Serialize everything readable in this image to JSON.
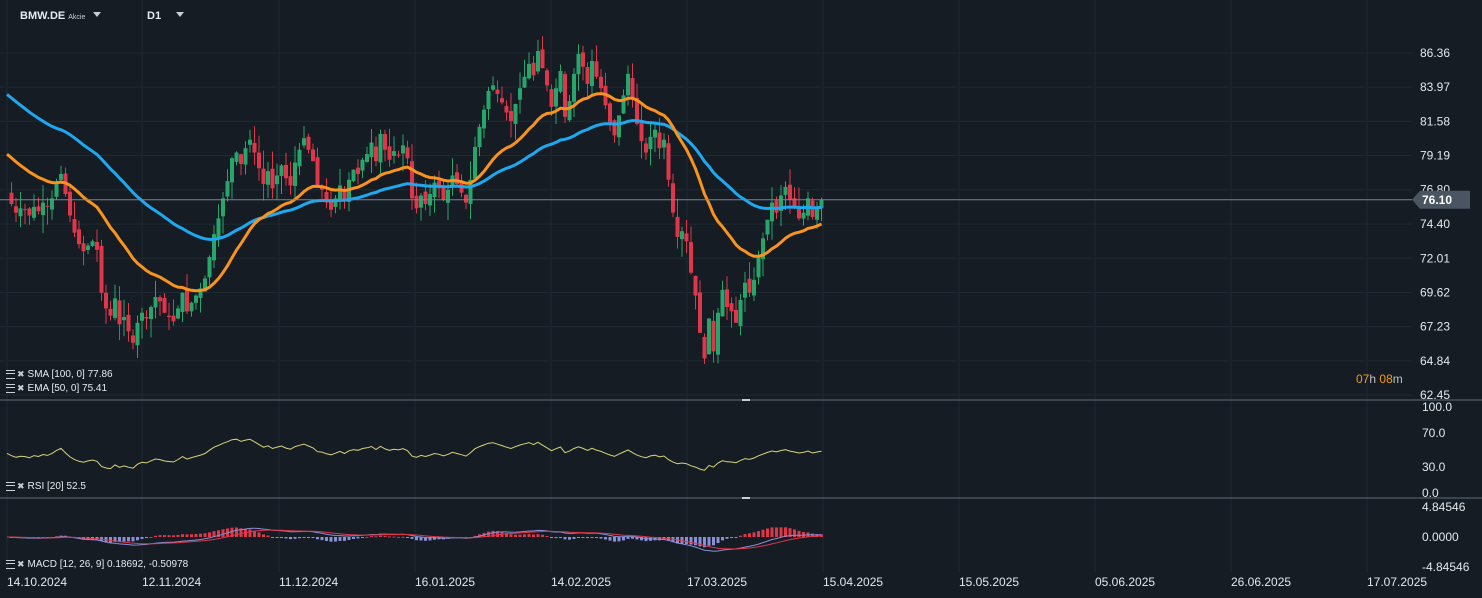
{
  "header": {
    "symbol": "BMW.DE",
    "instrument_type": "Akcie",
    "timeframe": "D1"
  },
  "countdown": {
    "hours": "07",
    "h_unit": "h",
    "minutes": "08",
    "m_unit": "m"
  },
  "colors": {
    "background": "#151c24",
    "grid": "#1f2933",
    "up": "#26a66b",
    "down": "#e0364a",
    "sma": "#1ea8f0",
    "ema": "#f7931e",
    "rsi": "#d8d27a",
    "macd": "#8a8fd6",
    "signal": "#e0364a",
    "price_tag": "#4a5561"
  },
  "legends": {
    "sma": "SMA [100, 0] 77.86",
    "ema": "EMA [50, 0] 75.41",
    "rsi": "RSI [20] 52.5",
    "macd": "MACD [12, 26, 9] 0.18692, -0.50978"
  },
  "chart_data": {
    "type": "candlestick",
    "x_tick_labels": [
      "14.10.2024",
      "12.11.2024",
      "11.12.2024",
      "16.01.2025",
      "14.02.2025",
      "17.03.2025",
      "15.04.2025",
      "15.05.2025",
      "05.06.2025",
      "26.06.2025",
      "17.07.2025"
    ],
    "price_ticks": [
      "86.36",
      "83.97",
      "81.58",
      "79.19",
      "76.80",
      "74.40",
      "72.01",
      "69.62",
      "67.23",
      "64.84",
      "62.45"
    ],
    "price_range": [
      62.45,
      88.0
    ],
    "last_price": "76.10",
    "rsi_ticks": [
      "100.0",
      "70.0",
      "30.0",
      "0.0"
    ],
    "macd_ticks": [
      "4.84546",
      "0.0000",
      "-4.84546"
    ],
    "macd_range": [
      -4.84546,
      4.84546
    ],
    "closes": [
      76.6,
      75.8,
      75.2,
      75.5,
      75.4,
      75.0,
      75.6,
      75.3,
      75.9,
      75.6,
      76.2,
      77.2,
      77.9,
      76.5,
      75.0,
      73.8,
      73.0,
      72.5,
      72.9,
      73.2,
      72.6,
      69.6,
      68.5,
      68.0,
      69.2,
      67.4,
      67.9,
      66.9,
      66.1,
      67.5,
      68.2,
      67.8,
      68.6,
      69.3,
      69.0,
      68.2,
      67.9,
      67.6,
      68.5,
      69.6,
      68.3,
      68.9,
      69.4,
      69.9,
      70.6,
      72.1,
      73.7,
      74.8,
      76.2,
      77.4,
      79.0,
      79.4,
      78.6,
      79.7,
      80.3,
      79.4,
      78.3,
      77.2,
      78.1,
      76.9,
      77.8,
      78.5,
      77.6,
      77.1,
      78.7,
      79.6,
      80.4,
      79.6,
      78.8,
      77.0,
      76.8,
      75.9,
      75.4,
      76.2,
      77.1,
      76.1,
      77.5,
      78.2,
      77.9,
      78.9,
      79.3,
      80.1,
      78.8,
      80.7,
      79.6,
      78.9,
      79.5,
      79.2,
      79.9,
      79.0,
      76.2,
      75.5,
      76.4,
      75.8,
      76.5,
      77.3,
      76.9,
      76.1,
      76.8,
      77.8,
      77.2,
      76.6,
      75.9,
      77.5,
      79.8,
      81.2,
      82.4,
      83.7,
      84.1,
      83.5,
      82.9,
      82.2,
      81.6,
      82.8,
      83.9,
      84.7,
      85.6,
      84.8,
      86.5,
      85.3,
      84.1,
      82.6,
      83.9,
      85.1,
      81.9,
      83.0,
      84.9,
      86.3,
      85.4,
      84.2,
      85.8,
      84.7,
      83.9,
      82.7,
      81.5,
      80.6,
      82.0,
      83.4,
      84.9,
      83.1,
      81.4,
      80.2,
      79.4,
      80.5,
      81.0,
      79.7,
      80.3,
      77.5,
      75.2,
      73.5,
      73.9,
      73.2,
      71.0,
      69.4,
      66.8,
      65.0,
      67.8,
      65.5,
      68.2,
      69.8,
      68.6,
      68.3,
      67.5,
      69.1,
      70.3,
      69.6,
      70.5,
      72.1,
      73.4,
      74.7,
      75.9,
      75.2,
      76.4,
      77.0,
      76.1,
      75.5,
      74.8,
      75.2,
      76.2,
      74.9,
      75.6,
      76.1
    ]
  }
}
